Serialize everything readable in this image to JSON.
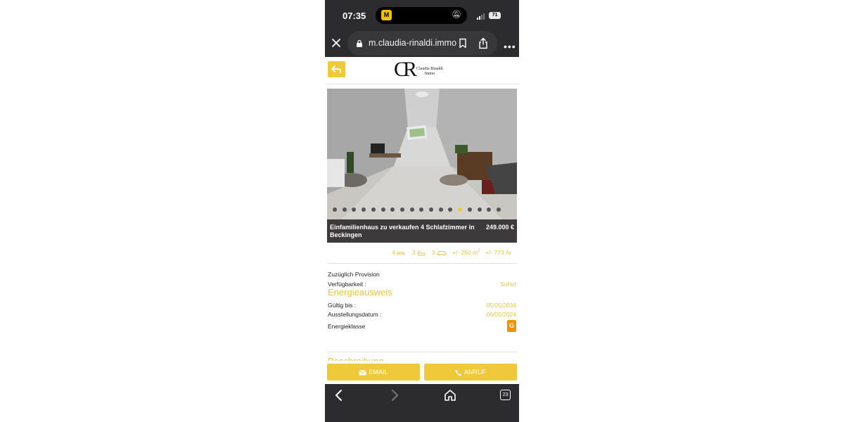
{
  "status": {
    "time": "07:35",
    "battery": "71"
  },
  "browser": {
    "url": "m.claudia-rinaldi.immo",
    "tabs_count": "23"
  },
  "brand": {
    "logo_initials": "CR",
    "logo_name_line1": "Claudia Rinaldi",
    "logo_name_line2": "Immo"
  },
  "listing": {
    "title": "Einfamilienhaus zu verkaufen 4 Schlafzimmer in Beckingen",
    "price": "249.000 €",
    "image_count": 18,
    "active_image_index": 13,
    "features": {
      "bedrooms": "4",
      "bathrooms": "3",
      "garages": "3",
      "living_area": "+/- 260 m",
      "living_area_sup": "2",
      "land_area": "+/- 773 Ar"
    }
  },
  "details": {
    "provision": "Zuzüglich Provision",
    "availability_label": "Verfügbarkeit :",
    "availability_value": "Sofort"
  },
  "energy": {
    "section_title": "Energieausweis",
    "valid_until_label": "Gültig bis :",
    "valid_until_value": "05/05/2034",
    "issue_date_label": "Ausstellungsdatum :",
    "issue_date_value": "06/05/2024",
    "class_label": "Energieklasse",
    "class_value": "G",
    "class_color": "#f39200"
  },
  "next_section_title": "Beschreibung",
  "actions": {
    "email_label": "EMAIL",
    "call_label": "ANRUF"
  },
  "colors": {
    "accent": "#f0c93a",
    "browser_chrome": "#2c2c2e"
  }
}
